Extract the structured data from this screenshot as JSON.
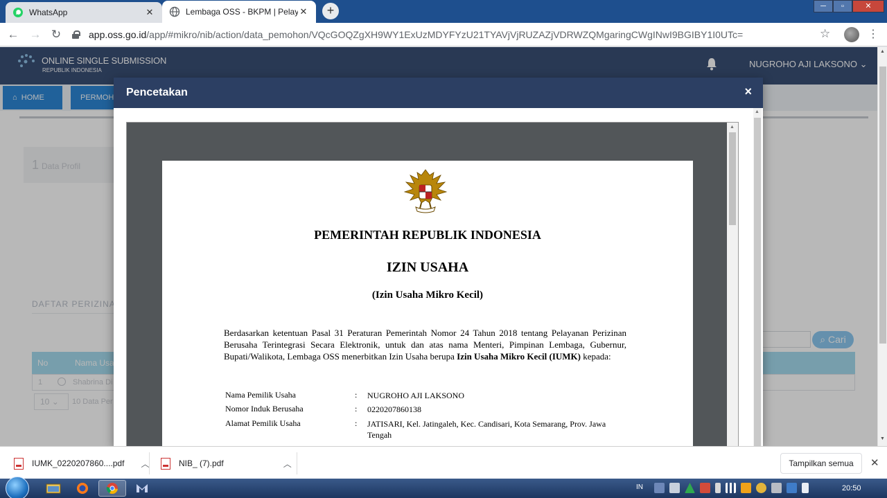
{
  "browser": {
    "tabs": [
      {
        "title": "WhatsApp",
        "close": "✕"
      },
      {
        "title": "Lembaga OSS - BKPM | Pelayana",
        "close": "✕"
      }
    ],
    "new_tab": "+",
    "url_host": "app.oss.go.id",
    "url_path": "/app/#mikro/nib/action/data_pemohon/VQcGOQZgXH9WY1ExUzMDYFYzU21TYAVjVjRUZAZjVDRWZQMgaringCWgINwI9BGIBY1I0UTc="
  },
  "app": {
    "logo_title": "ONLINE SINGLE SUBMISSION",
    "logo_subtitle": "REPUBLIK INDONESIA",
    "user_name": "NUGROHO AJI LAKSONO",
    "nav": [
      "HOME",
      "PERMOHO"
    ],
    "step": {
      "number": "1",
      "label": "Data Profil"
    },
    "list_title": "DAFTAR PERIZINA",
    "search_button": "Cari",
    "table_headers": [
      "No",
      "Nama Usa"
    ],
    "table_row": {
      "no": "1",
      "name": "Shabrina Di"
    },
    "page_size": "10",
    "page_size_label": "10 Data Per"
  },
  "modal": {
    "title": "Pencetakan",
    "close": "×"
  },
  "document": {
    "government": "PEMERINTAH REPUBLIK INDONESIA",
    "title": "IZIN USAHA",
    "subtitle": "(Izin Usaha Mikro Kecil)",
    "body_text": "Berdasarkan ketentuan Pasal 31 Peraturan Pemerintah Nomor 24 Tahun 2018 tentang Pelayanan Perizinan Berusaha Terintegrasi Secara Elektronik, untuk dan atas nama Menteri, Pimpinan Lembaga, Gubernur, Bupati/Walikota, Lembaga OSS menerbitkan Izin Usaha berupa",
    "body_bold": "Izin Usaha Mikro Kecil (IUMK)",
    "body_end": "kepada:",
    "fields": [
      {
        "label": "Nama Pemilik Usaha",
        "sep": ":",
        "value": "NUGROHO AJI LAKSONO"
      },
      {
        "label": "Nomor Induk Berusaha",
        "sep": ":",
        "value": "0220207860138"
      },
      {
        "label": "Alamat Pemilik Usaha",
        "sep": ":",
        "value": "JATISARI, Kel. Jatingaleh, Kec. Candisari, Kota Semarang, Prov. Jawa Tengah"
      }
    ]
  },
  "downloads": {
    "items": [
      "IUMK_0220207860....pdf",
      "NIB_ (7).pdf"
    ],
    "show_all": "Tampilkan semua"
  },
  "taskbar": {
    "language": "IN",
    "clock": "20:50"
  },
  "colors": {
    "modal_header": "#2c3f63",
    "app_header": "#3a4f75",
    "nav_accent": "#2d87d6",
    "taskbar": "#1c3660"
  }
}
